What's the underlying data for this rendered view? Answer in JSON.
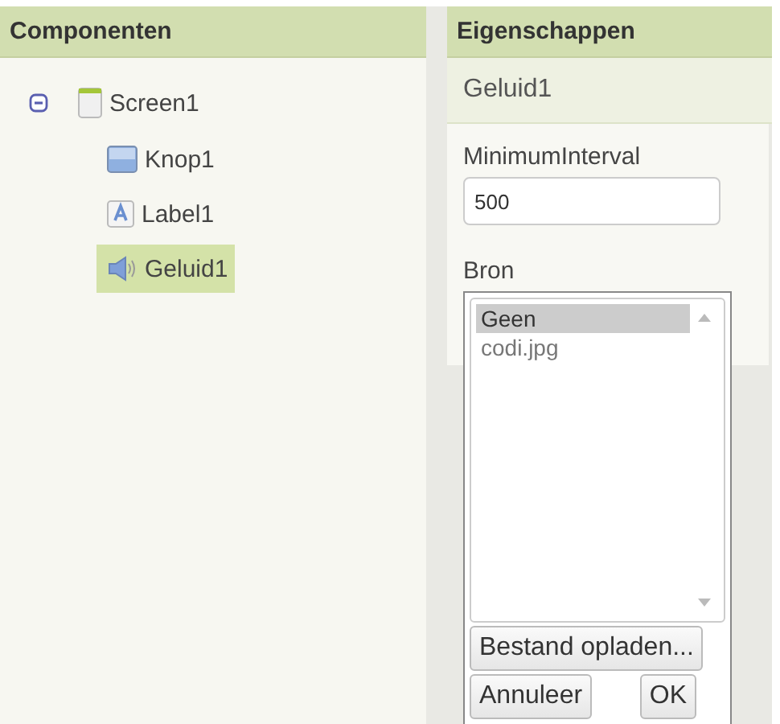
{
  "components": {
    "title": "Componenten",
    "tree": [
      {
        "label": "Screen1",
        "kind": "screen",
        "expanded": true,
        "selected": false,
        "children": [
          {
            "label": "Knop1",
            "kind": "button",
            "selected": false
          },
          {
            "label": "Label1",
            "kind": "label",
            "selected": false
          },
          {
            "label": "Geluid1",
            "kind": "sound",
            "selected": true
          }
        ]
      }
    ]
  },
  "properties": {
    "title": "Eigenschappen",
    "component": "Geluid1",
    "fields": [
      {
        "label": "MinimumInterval",
        "value": "500"
      }
    ],
    "source_label": "Bron"
  },
  "picker": {
    "options": [
      {
        "label": "Geen",
        "selected": true
      },
      {
        "label": "codi.jpg",
        "selected": false
      }
    ],
    "upload_button": "Bestand opladen...",
    "cancel_button": "Annuleer",
    "ok_button": "OK"
  }
}
